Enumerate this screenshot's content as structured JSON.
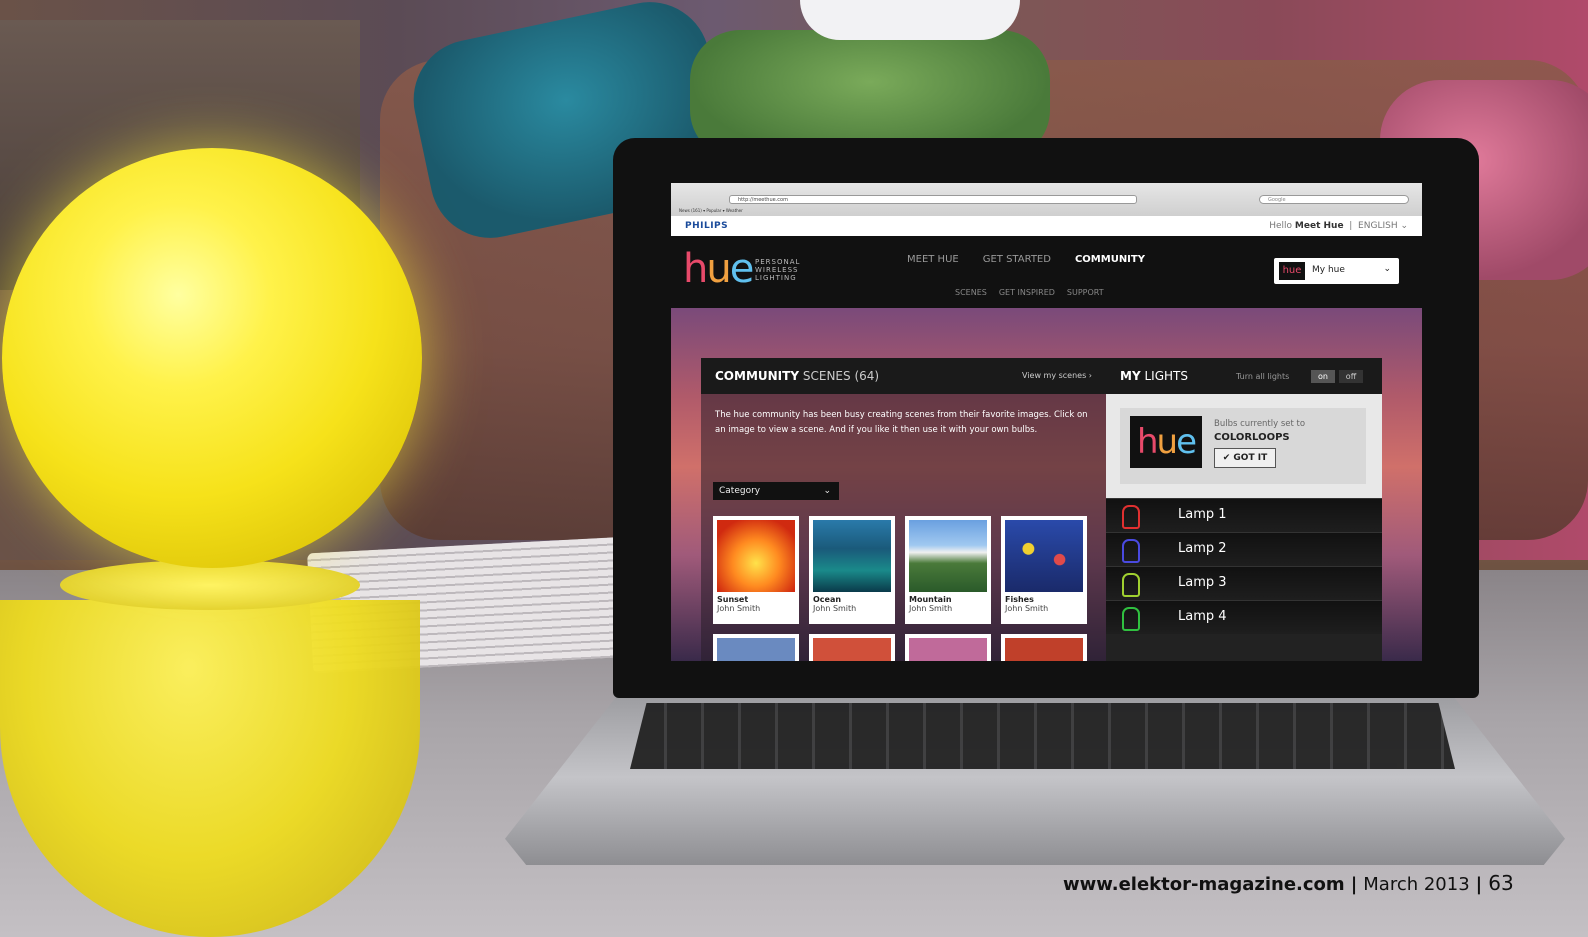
{
  "browser": {
    "url": "http://meethue.com",
    "search_placeholder": "Google",
    "bookmarks": "News (161) ▾   Popular ▾   Weather"
  },
  "site": {
    "brand": "PHILIPS",
    "greeting_prefix": "Hello",
    "greeting_name": "Meet Hue",
    "language": "ENGLISH",
    "logo_letters": [
      "h",
      "u",
      "e"
    ],
    "tagline": [
      "PERSONAL",
      "WIRELESS",
      "LIGHTING"
    ],
    "nav": [
      "MEET HUE",
      "GET STARTED",
      "COMMUNITY"
    ],
    "nav_active": "COMMUNITY",
    "subnav": [
      "SCENES",
      "GET INSPIRED",
      "SUPPORT"
    ],
    "myhue_label": "My hue",
    "myhue_logo": "hue"
  },
  "community": {
    "title_bold": "COMMUNITY",
    "title_rest": "SCENES",
    "count": "(64)",
    "view_link": "View my scenes  ›",
    "intro": "The hue community has been busy creating scenes from their favorite images. Click on an image to view a scene. And if you like it then use it with your own bulbs.",
    "category": "Category",
    "scenes": [
      {
        "name": "Sunset",
        "author": "John Smith",
        "image": "img-sunset"
      },
      {
        "name": "Ocean",
        "author": "John Smith",
        "image": "img-ocean"
      },
      {
        "name": "Mountain",
        "author": "John Smith",
        "image": "img-mountain"
      },
      {
        "name": "Fishes",
        "author": "John Smith",
        "image": "img-fishes"
      }
    ]
  },
  "lights": {
    "title_bold": "MY",
    "title_rest": "LIGHTS",
    "turn_all": "Turn all lights",
    "on_label": "on",
    "off_label": "off",
    "bulbs_prefix": "Bulbs currently set to",
    "bulbs_mode": "COLORLOOPS",
    "got_it": "✔ GOT IT",
    "lamps": [
      {
        "name": "Lamp 1",
        "color": "#e03030"
      },
      {
        "name": "Lamp 2",
        "color": "#4a4ae0"
      },
      {
        "name": "Lamp 3",
        "color": "#a0d030"
      },
      {
        "name": "Lamp 4",
        "color": "#30c040"
      }
    ]
  },
  "footer": {
    "site": "www.elektor-magazine.com",
    "date": "March 2013",
    "page": "63"
  }
}
